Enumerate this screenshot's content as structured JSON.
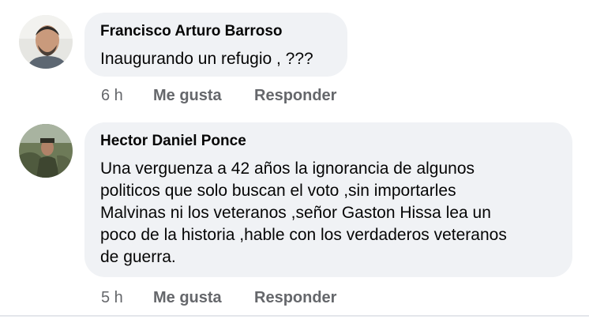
{
  "comments": [
    {
      "author": "Francisco Arturo Barroso",
      "text": "Inaugurando un refugio , ???",
      "time": "6 h",
      "like_label": "Me gusta",
      "reply_label": "Responder"
    },
    {
      "author": "Hector Daniel Ponce",
      "text": "Una verguenza a 42 años la ignorancia de algunos\npoliticos que solo buscan el voto ,sin importarles\nMalvinas ni los veteranos ,señor Gaston Hissa lea un\npoco de la historia ,hable con los verdaderos veteranos\nde guerra.",
      "time": "5 h",
      "like_label": "Me gusta",
      "reply_label": "Responder"
    }
  ],
  "colors": {
    "bubble": "#f0f2f5",
    "meta_text": "#65676b",
    "body_text": "#050505"
  },
  "icons": [
    "user-avatar-francisco",
    "user-avatar-hector"
  ]
}
